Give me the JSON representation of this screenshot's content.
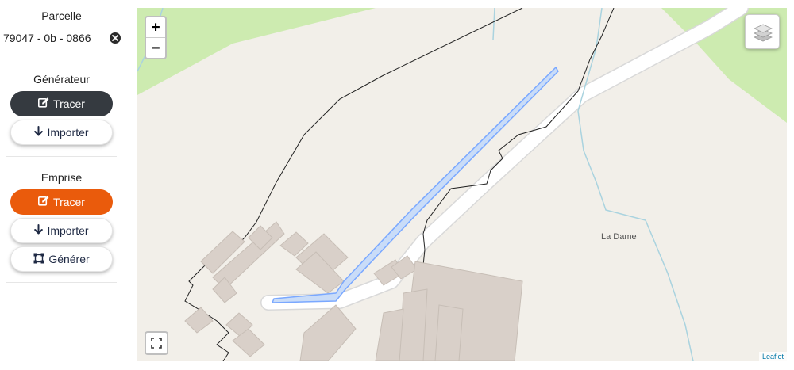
{
  "sidebar": {
    "parcelle": {
      "title": "Parcelle",
      "reference": "79047 - 0b - 0866"
    },
    "generateur": {
      "title": "Générateur",
      "trace_label": "Tracer",
      "import_label": "Importer"
    },
    "emprise": {
      "title": "Emprise",
      "trace_label": "Tracer",
      "import_label": "Importer",
      "generate_label": "Générer"
    }
  },
  "map": {
    "place_label": "La Dame",
    "attribution": "Leaflet",
    "zoom_in_label": "+",
    "zoom_out_label": "−"
  },
  "colors": {
    "accent_orange": "#ea5b0c",
    "dark_button": "#353a40",
    "map_background": "#f2efe9",
    "building": "#d9d0c9",
    "meadow": "#cdebb0",
    "stream": "#aad3df",
    "drawn_line": "#7aa8ff"
  }
}
